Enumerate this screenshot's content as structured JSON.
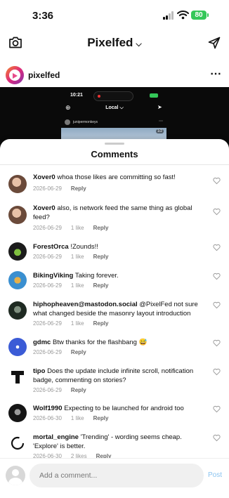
{
  "status_bar": {
    "time": "3:36",
    "battery": "80"
  },
  "top_bar": {
    "title": "Pixelfed"
  },
  "post": {
    "username": "pixelfed"
  },
  "preview": {
    "time": "10:21",
    "tab": "Local",
    "username": "junipermonkeys",
    "badge": "1/2"
  },
  "sheet": {
    "title": "Comments"
  },
  "comments": [
    {
      "user": "Xover0",
      "text": "whoa those likes are committing so fast!",
      "date": "2026-06-29",
      "likes": "",
      "reply": "Reply"
    },
    {
      "user": "Xover0",
      "text": "also, is network feed the same thing as global feed?",
      "date": "2026-06-29",
      "likes": "1 like",
      "reply": "Reply"
    },
    {
      "user": "ForestOrca",
      "text": "!Zounds!!",
      "date": "2026-06-29",
      "likes": "1 like",
      "reply": "Reply"
    },
    {
      "user": "BikingViking",
      "text": "Taking forever.",
      "date": "2026-06-29",
      "likes": "1 like",
      "reply": "Reply"
    },
    {
      "user": "hiphopheaven@mastodon.social",
      "text": "@PixelFed  not sure what changed beside the masonry layout introduction",
      "date": "2026-06-29",
      "likes": "1 like",
      "reply": "Reply"
    },
    {
      "user": "gdmc",
      "text": "Btw thanks for the flashbang 😅",
      "date": "2026-06-29",
      "likes": "",
      "reply": "Reply"
    },
    {
      "user": "tipo",
      "text": "Does the update include infinite scroll, notification badge, commenting on stories?",
      "date": "2026-06-29",
      "likes": "",
      "reply": "Reply"
    },
    {
      "user": "Wolf1990",
      "text": "Expecting to be launched for android too",
      "date": "2026-06-30",
      "likes": "1 like",
      "reply": "Reply"
    },
    {
      "user": "mortal_engine",
      "text": "'Trending' - wording seems cheap. 'Explore' is better.",
      "date": "2026-06-30",
      "likes": "2 likes",
      "reply": "Reply"
    }
  ],
  "composer": {
    "placeholder": "Add a comment...",
    "post_label": "Post"
  },
  "colors": {
    "accent": "#0095f6",
    "post_disabled": "#8bc4f0",
    "battery": "#34c759"
  },
  "icons": [
    "camera-icon",
    "chevron-down-icon",
    "send-icon",
    "more-icon",
    "heart-icon"
  ]
}
